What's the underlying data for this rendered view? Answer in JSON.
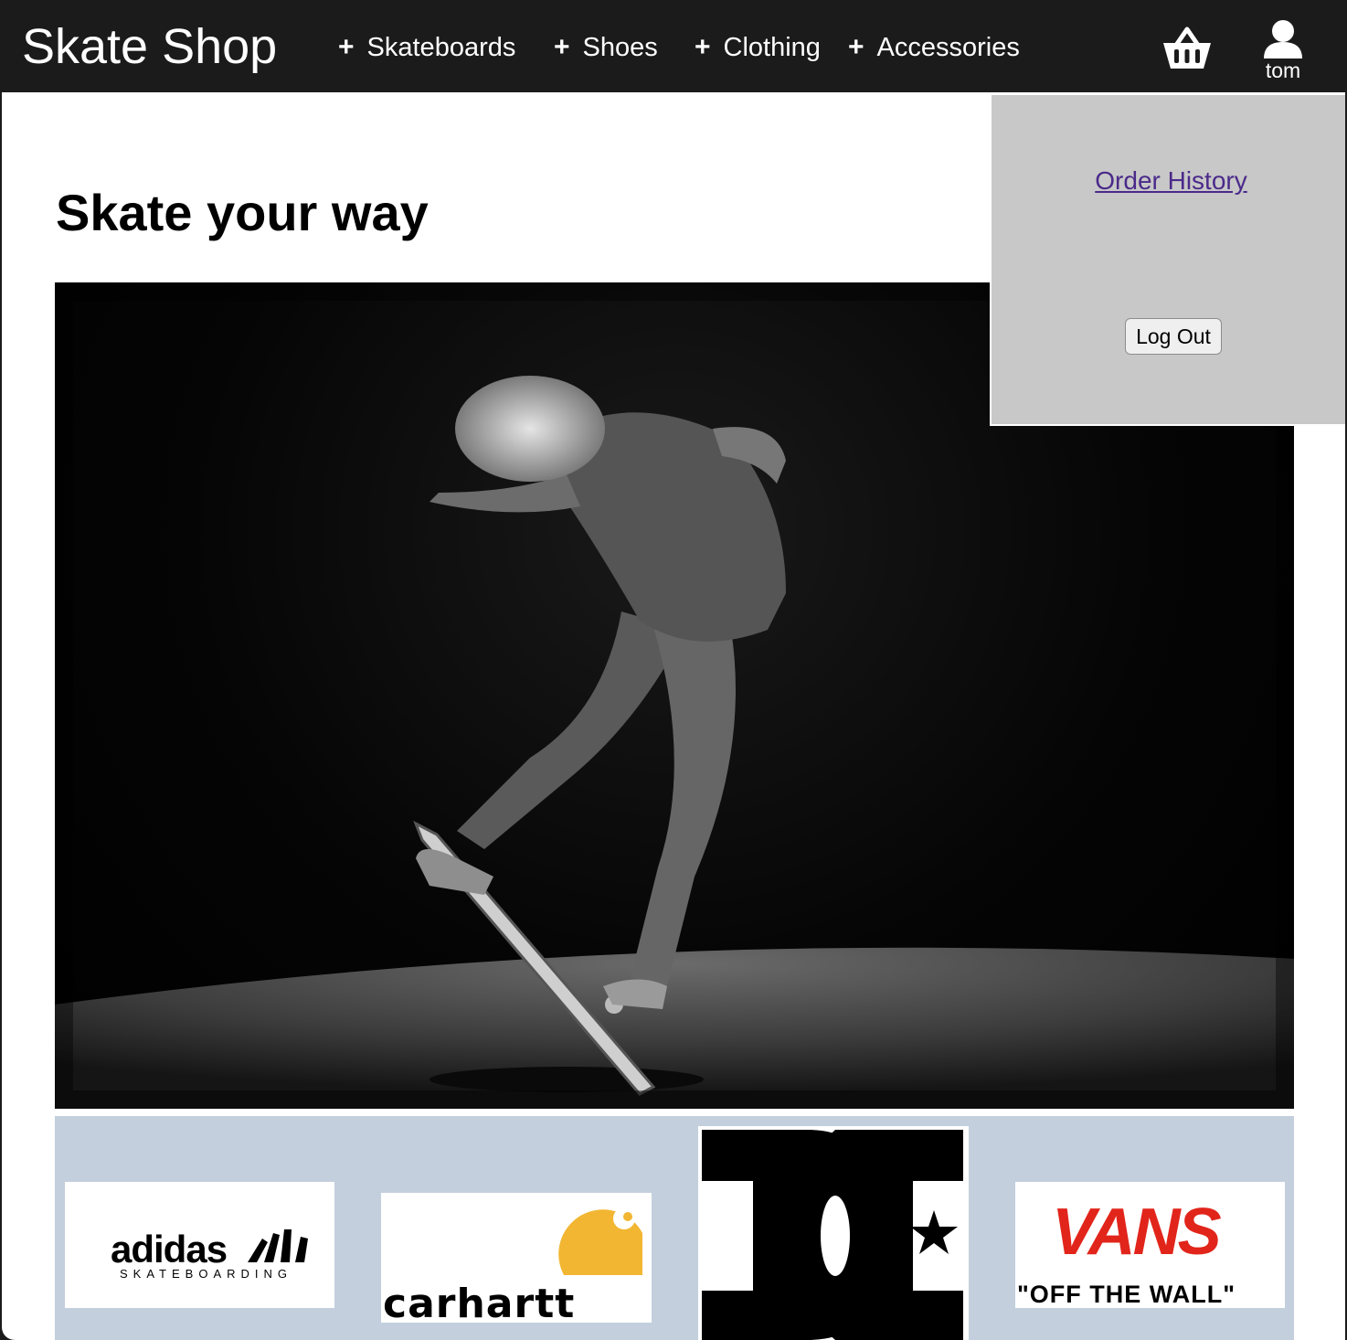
{
  "header": {
    "brand": "Skate Shop",
    "nav": [
      {
        "plus": "+",
        "label": "Skateboards"
      },
      {
        "plus": "+",
        "label": "Shoes"
      },
      {
        "plus": "+",
        "label": "Clothing"
      },
      {
        "plus": "+",
        "label": "Accessories"
      }
    ],
    "basket_icon": "basket-icon",
    "user_icon": "user-icon",
    "username": "tom"
  },
  "user_menu": {
    "order_history": "Order History",
    "logout": "Log Out"
  },
  "hero": {
    "title": "Skate your way",
    "image": "black-and-white skateboarder performing trick"
  },
  "brands": [
    {
      "name": "adidas",
      "tagline": "SKATEBOARDING"
    },
    {
      "name": "carhartt"
    },
    {
      "name": "DC"
    },
    {
      "name": "VANS",
      "tagline": "\"OFF THE WALL\""
    }
  ],
  "colors": {
    "topbar": "#1b1b1b",
    "dropdown": "#c8c8c8",
    "brand_strip": "#c3cfdc",
    "link": "#4b2a8a",
    "vans_red": "#e1251b",
    "carhartt_yellow": "#f2b632"
  }
}
